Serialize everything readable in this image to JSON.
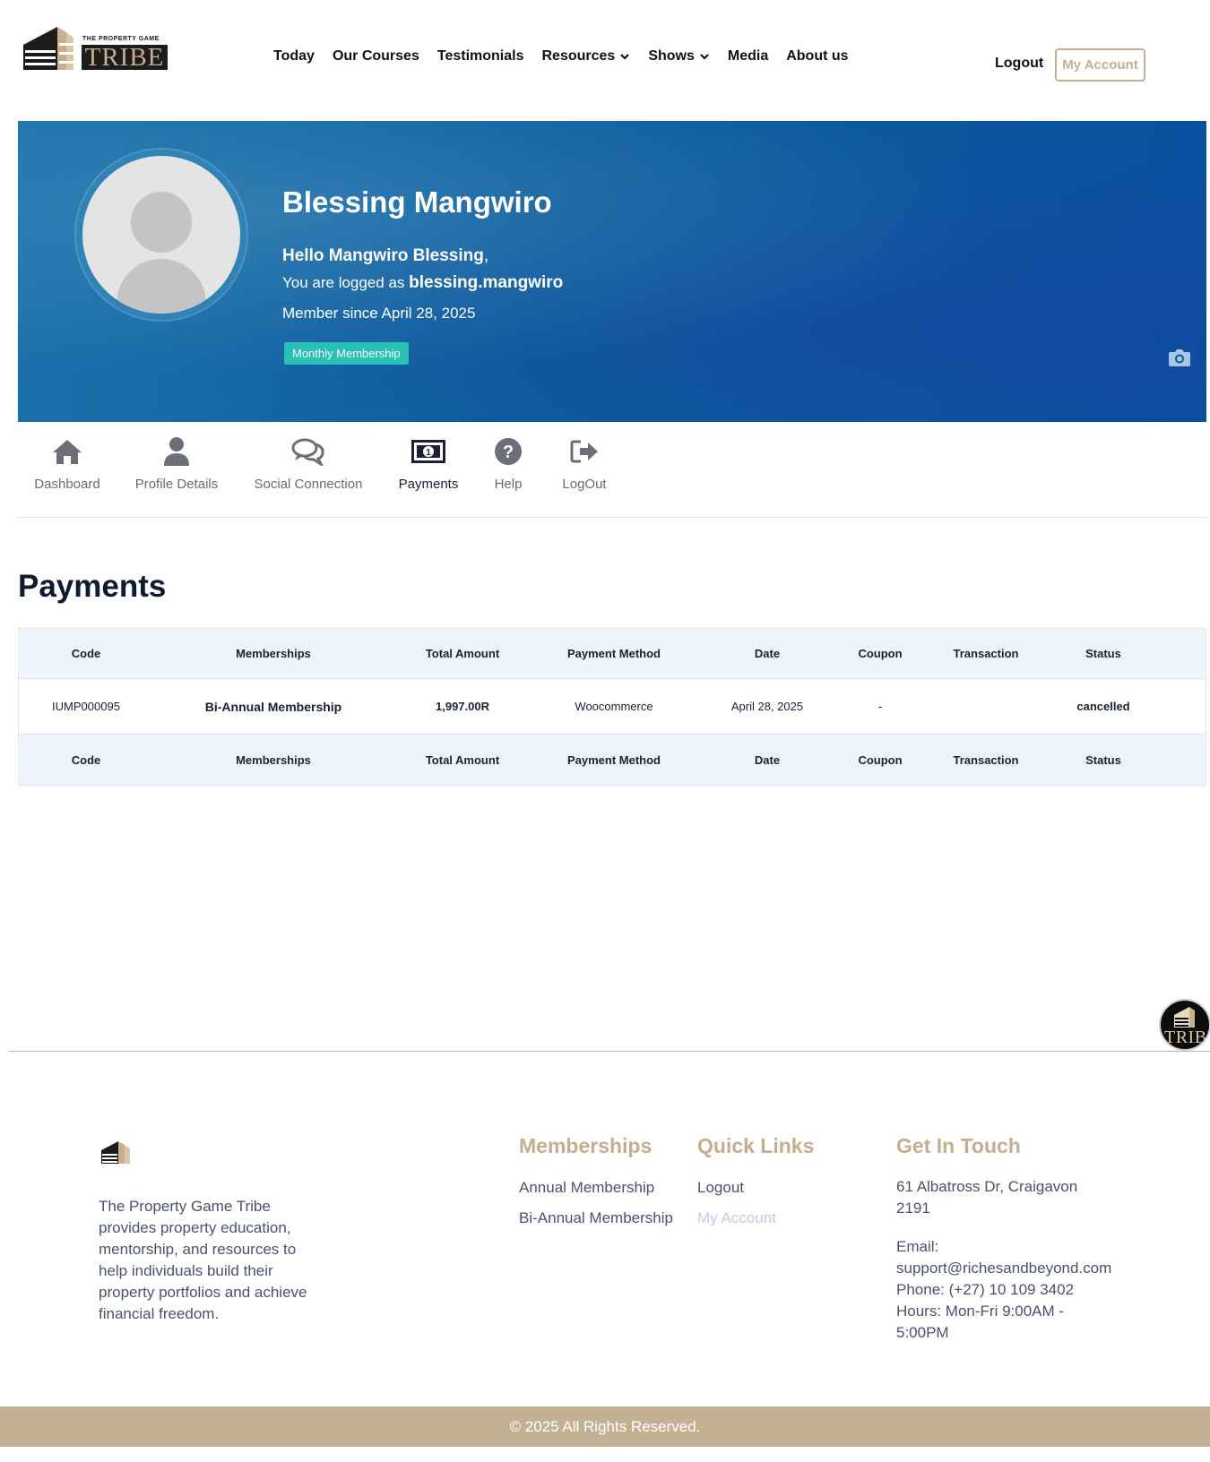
{
  "brand": {
    "tagline": "THE PROPERTY GAME",
    "wordmark": "TRIBE",
    "accent": "#c4b194",
    "banner_blue": "#0e5e9c"
  },
  "nav": {
    "items": [
      {
        "label": "Today",
        "dropdown": false
      },
      {
        "label": "Our Courses",
        "dropdown": false
      },
      {
        "label": "Testimonials",
        "dropdown": false
      },
      {
        "label": "Resources",
        "dropdown": true
      },
      {
        "label": "Shows",
        "dropdown": true
      },
      {
        "label": "Media",
        "dropdown": false
      },
      {
        "label": "About us",
        "dropdown": false
      }
    ],
    "logout": "Logout",
    "account": "My Account"
  },
  "profile": {
    "name": "Blessing Mangwiro",
    "hello": "Hello Mangwiro Blessing",
    "hello_suffix": ",",
    "logged_prefix": "You are logged as ",
    "username": "blessing.mangwiro",
    "member_since": "Member since April 28, 2025",
    "badge": "Monthly Membership",
    "badge_color": "#29c0b6"
  },
  "tabs": [
    {
      "label": "Dashboard",
      "icon": "home-icon",
      "active": false
    },
    {
      "label": "Profile Details",
      "icon": "user-icon",
      "active": false
    },
    {
      "label": "Social Connection",
      "icon": "comments-icon",
      "active": false
    },
    {
      "label": "Payments",
      "icon": "money-bill-icon",
      "active": true
    },
    {
      "label": "Help",
      "icon": "question-circle-icon",
      "active": false
    },
    {
      "label": "LogOut",
      "icon": "sign-out-icon",
      "active": false
    }
  ],
  "payments": {
    "title": "Payments",
    "columns": [
      "Code",
      "Memberships",
      "Total Amount",
      "Payment Method",
      "Date",
      "Coupon",
      "Transaction",
      "Status"
    ],
    "rows": [
      [
        "IUMP000095",
        "Bi-Annual Membership",
        "1,997.00R",
        "Woocommerce",
        "April 28, 2025",
        "-",
        "",
        "cancelled"
      ]
    ]
  },
  "footer": {
    "description": "The Property Game Tribe provides property education, mentorship, and resources to help individuals build their property portfolios and achieve financial freedom.",
    "memberships_title": "Memberships",
    "memberships": [
      "Annual Membership",
      "Bi-Annual Membership"
    ],
    "quick_title": "Quick Links",
    "quick_links": [
      "Logout",
      "My Account"
    ],
    "contact_title": "Get In Touch",
    "address_line1": "61 Albatross Dr, Craigavon",
    "address_line2": "2191",
    "email_label": "Email:",
    "email": "support@richesandbeyond.com",
    "phone": "Phone: (+27) 10 109 3402",
    "hours_line1": "Hours: Mon-Fri 9:00AM -",
    "hours_line2": "5:00PM",
    "copyright": "© 2025 All Rights Reserved."
  }
}
